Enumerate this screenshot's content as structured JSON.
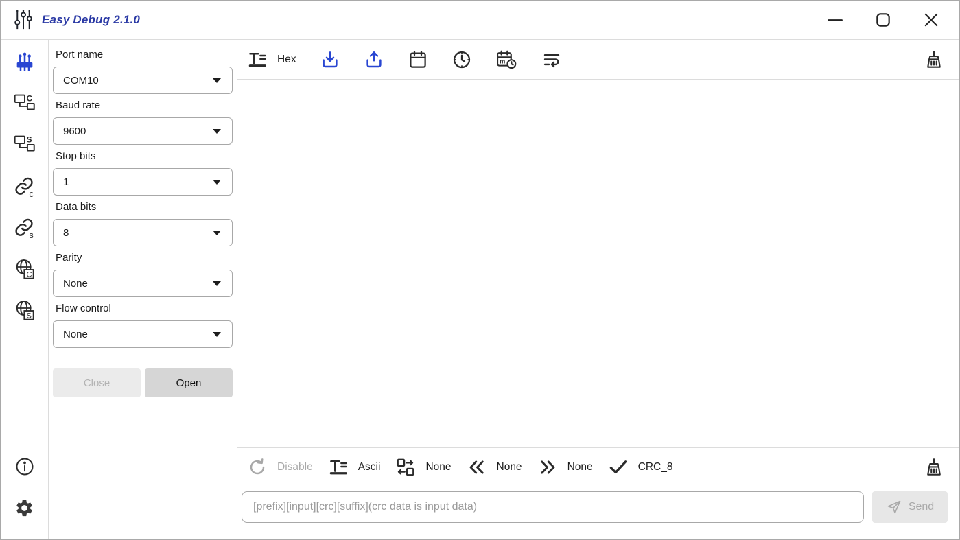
{
  "window": {
    "title": "Easy Debug 2.1.0"
  },
  "colors": {
    "title_blue": "#2b3aa5",
    "icon_blue": "#2946d2"
  },
  "sidebar": {
    "tcp_client_letter": "C",
    "tcp_server_letter": "S",
    "link_client_letter": "c",
    "link_server_letter": "s",
    "web_client_letter": "C",
    "web_server_letter": "S"
  },
  "settings": {
    "fields": [
      {
        "label": "Port name",
        "value": "COM10"
      },
      {
        "label": "Baud rate",
        "value": "9600"
      },
      {
        "label": "Stop bits",
        "value": "1"
      },
      {
        "label": "Data bits",
        "value": "8"
      },
      {
        "label": "Parity",
        "value": "None"
      },
      {
        "label": "Flow control",
        "value": "None"
      }
    ],
    "close_label": "Close",
    "open_label": "Open"
  },
  "log_toolbar": {
    "format_label": "Hex",
    "time_format_letter": "m"
  },
  "send_toolbar": {
    "loop_label": "Disable",
    "format_label": "Ascii",
    "transform_label": "None",
    "prefix_label": "None",
    "suffix_label": "None",
    "crc_label": "CRC_8"
  },
  "send_area": {
    "input_value": "",
    "input_placeholder": "[prefix][input][crc][suffix](crc data is input data)",
    "send_label": "Send"
  }
}
